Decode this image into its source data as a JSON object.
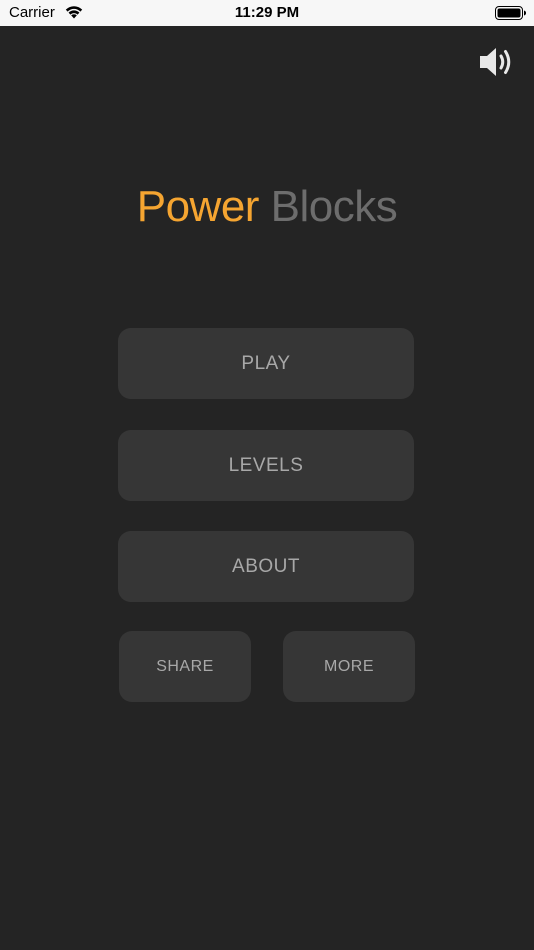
{
  "status_bar": {
    "carrier": "Carrier",
    "time": "11:29 PM",
    "wifi_icon": "wifi-icon",
    "battery_icon": "battery-icon"
  },
  "header": {
    "sound_icon": "speaker-icon"
  },
  "title": {
    "word1": "Power",
    "word2": "Blocks",
    "word1_color": "#f5a531",
    "word2_color": "#6d6d6d"
  },
  "menu": {
    "play": "PLAY",
    "levels": "LEVELS",
    "about": "ABOUT",
    "share": "SHARE",
    "more": "MORE"
  },
  "colors": {
    "background": "#242424",
    "button_bg": "#363636",
    "button_text": "#a8a8a8",
    "status_bar_bg": "#f7f7f7"
  }
}
